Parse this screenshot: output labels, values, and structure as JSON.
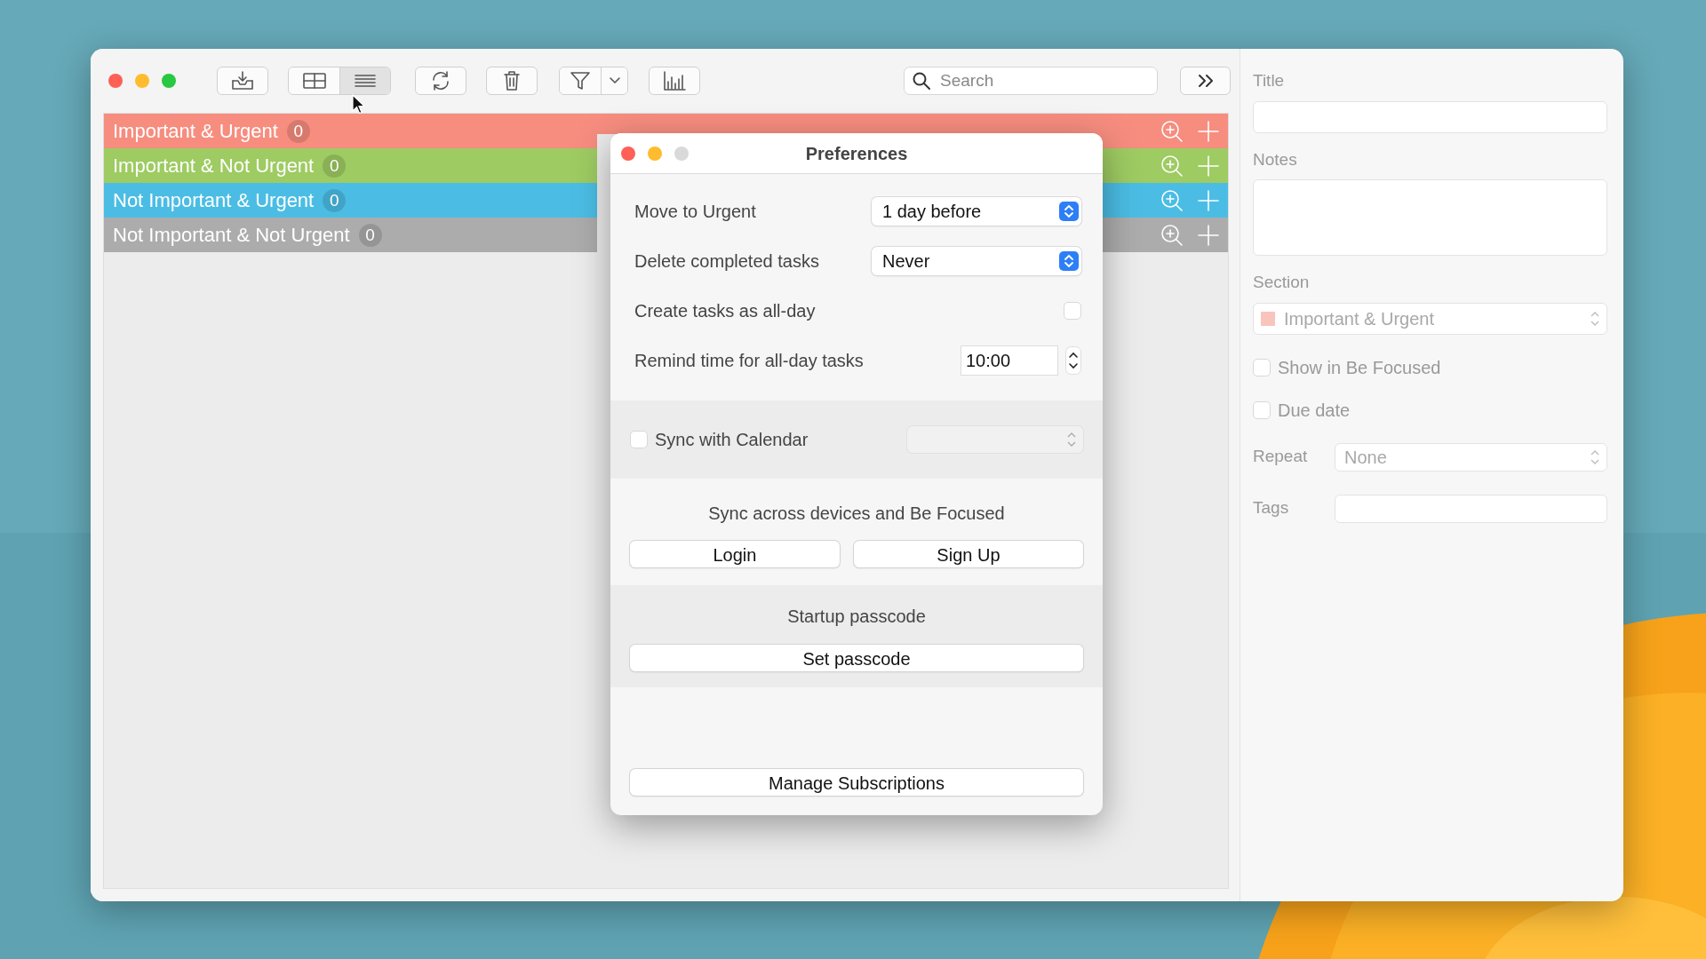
{
  "toolbar": {
    "view_modes": [
      {
        "selected": false
      },
      {
        "selected": true
      }
    ],
    "search": {
      "placeholder": "Search"
    }
  },
  "sections": [
    {
      "name": "Important & Urgent",
      "count": "0",
      "color": "#f68d7f"
    },
    {
      "name": "Important & Not Urgent",
      "count": "0",
      "color": "#9ecb62"
    },
    {
      "name": "Not Important & Urgent",
      "count": "0",
      "color": "#4bbde4"
    },
    {
      "name": "Not Important & Not Urgent",
      "count": "0",
      "color": "#acacac"
    }
  ],
  "preferences": {
    "title": "Preferences",
    "settings": [
      {
        "kind": "select",
        "label": "Move to Urgent",
        "value": "1 day before"
      },
      {
        "kind": "select",
        "label": "Delete completed tasks",
        "value": "Never"
      },
      {
        "kind": "checkbox",
        "label": "Create tasks as all-day",
        "checked": false
      },
      {
        "kind": "time",
        "label": "Remind time for all-day tasks",
        "value": "10:00"
      }
    ],
    "calendar_sync": {
      "label": "Sync with Calendar",
      "checked": false
    },
    "account": {
      "text": "Sync across devices and Be Focused",
      "buttons": [
        "Login",
        "Sign Up"
      ]
    },
    "passcode": {
      "label": "Startup passcode",
      "button": "Set passcode"
    },
    "subscriptions_button": "Manage Subscriptions"
  },
  "details": {
    "disabled": true,
    "title_label": "Title",
    "notes_label": "Notes",
    "section_label": "Section",
    "section": {
      "value": "Important & Urgent",
      "color": "#f9c4bd"
    },
    "options": [
      {
        "label": "Show in Be Focused",
        "checked": false
      },
      {
        "label": "Due date",
        "checked": false
      }
    ],
    "repeat": {
      "label": "Repeat",
      "value": "None"
    },
    "tags_label": "Tags"
  }
}
